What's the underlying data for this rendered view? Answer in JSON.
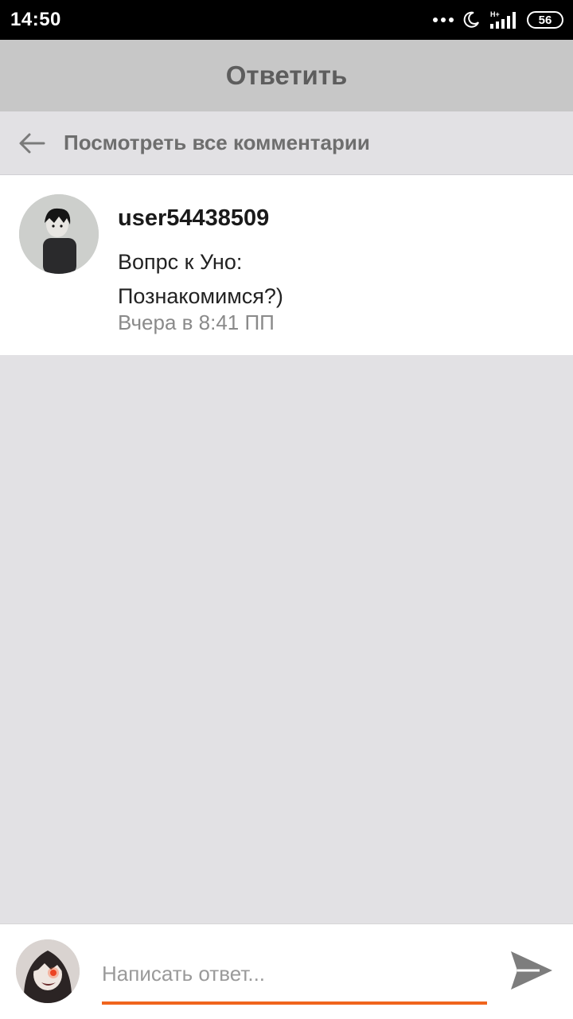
{
  "status_bar": {
    "time": "14:50",
    "network": "H+",
    "battery": "56",
    "icons": [
      "more-dots-icon",
      "moon-icon",
      "signal-icon",
      "battery-icon"
    ]
  },
  "header": {
    "title": "Ответить"
  },
  "nav": {
    "view_all_label": "Посмотреть все комментарии",
    "back_icon": "arrow-left-icon"
  },
  "comment": {
    "username": "user54438509",
    "text": "Вопрс к Уно:\nПознакомимся?)",
    "timestamp": "Вчера в 8:41 ПП"
  },
  "composer": {
    "placeholder": "Написать ответ...",
    "value": "",
    "send_icon": "send-icon"
  },
  "colors": {
    "accent": "#f0651e",
    "header_bg": "#c7c7c7",
    "page_bg": "#e2e1e4",
    "title_text": "#5d5d5d"
  }
}
